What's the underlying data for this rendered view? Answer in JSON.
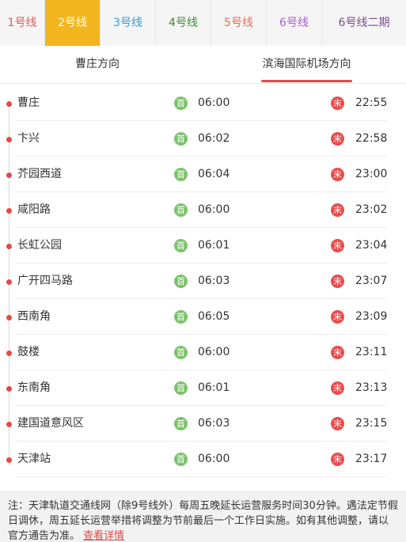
{
  "line_tabs": [
    {
      "label": "1号线",
      "color": "#e05a5a",
      "width": 57
    },
    {
      "label": "2号线",
      "color": "#ffffff",
      "width": 70,
      "active": true
    },
    {
      "label": "3号线",
      "color": "#3a9bd8",
      "width": 70
    },
    {
      "label": "4号线",
      "color": "#3a8a3a",
      "width": 70
    },
    {
      "label": "5号线",
      "color": "#e8704a",
      "width": 70
    },
    {
      "label": "6号线",
      "color": "#b05ad0",
      "width": 70
    },
    {
      "label": "6号线二期",
      "color": "#7a4a8a",
      "width": 106
    }
  ],
  "directions": {
    "left": "曹庄方向",
    "right": "滨海国际机场方向",
    "selected": "right"
  },
  "stations": [
    {
      "name": "曹庄",
      "first": "06:00",
      "last": "22:55"
    },
    {
      "name": "卞兴",
      "first": "06:02",
      "last": "22:58"
    },
    {
      "name": "芥园西道",
      "first": "06:04",
      "last": "23:00"
    },
    {
      "name": "咸阳路",
      "first": "06:00",
      "last": "23:02"
    },
    {
      "name": "长虹公园",
      "first": "06:01",
      "last": "23:04"
    },
    {
      "name": "广开四马路",
      "first": "06:03",
      "last": "23:07"
    },
    {
      "name": "西南角",
      "first": "06:05",
      "last": "23:09"
    },
    {
      "name": "鼓楼",
      "first": "06:00",
      "last": "23:11"
    },
    {
      "name": "东南角",
      "first": "06:01",
      "last": "23:13"
    },
    {
      "name": "建国道意风区",
      "first": "06:03",
      "last": "23:15"
    },
    {
      "name": "天津站",
      "first": "06:00",
      "last": "23:17"
    }
  ],
  "badges": {
    "first": "首",
    "last": "末"
  },
  "note": {
    "text": "注：天津轨道交通线网（除9号线外）每周五晚延长运营服务时间30分钟。遇法定节假日调休，周五延长运营举措将调整为节前最后一个工作日实施。如有其他调整，请以官方通告为准。",
    "link": "查看详情"
  },
  "colors": {
    "accent": "#f3b61f",
    "dot": "#e04b4b",
    "first_badge": "#7cc26a",
    "last_badge": "#e84c4c"
  }
}
